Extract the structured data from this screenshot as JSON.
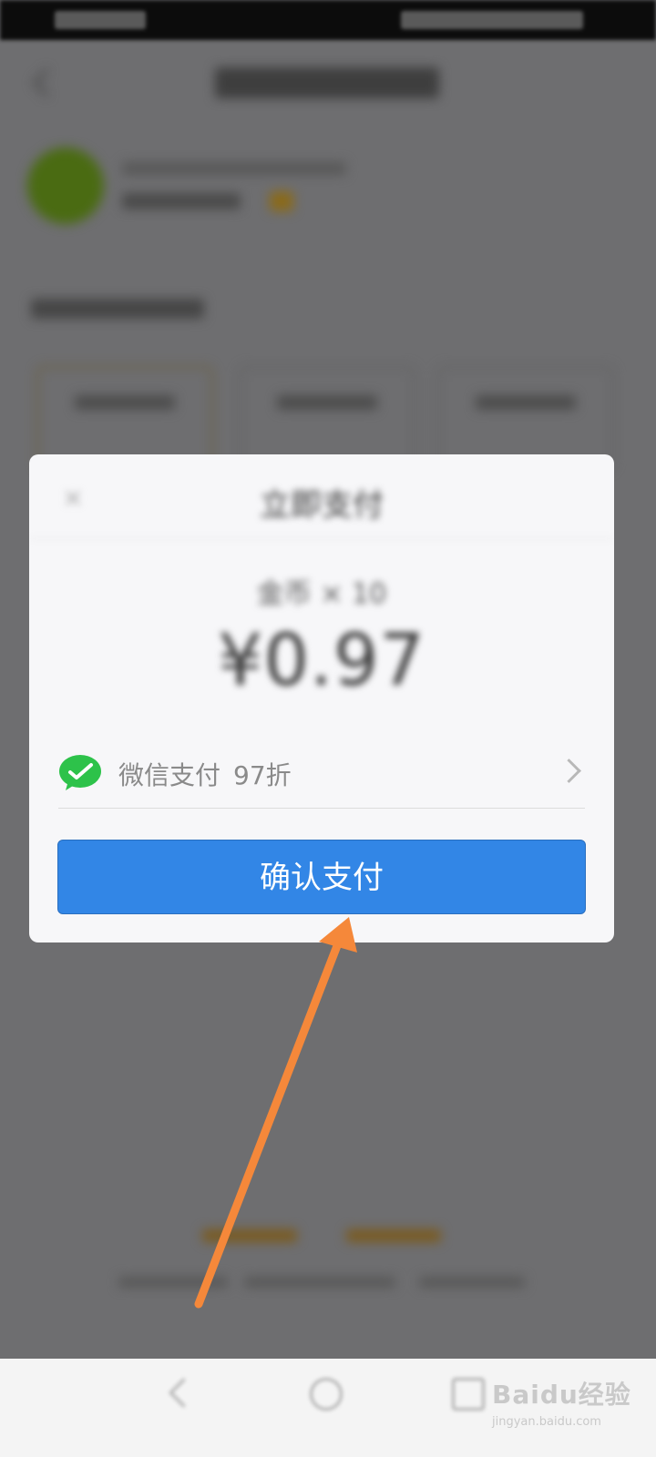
{
  "dialog": {
    "title": "立即支付",
    "product": "金币 × 10",
    "amount": "¥0.97",
    "payment_method": {
      "icon": "wechat-pay-icon",
      "label": "微信支付",
      "discount": "97折"
    },
    "confirm_label": "确认支付"
  },
  "watermark": {
    "logo": "Baidu经验",
    "url": "jingyan.baidu.com"
  },
  "colors": {
    "primary_button": "#3286e6",
    "wechat_green": "#2dc24a",
    "annotation_arrow": "#f5883a",
    "overlay": "#6e6e70"
  }
}
